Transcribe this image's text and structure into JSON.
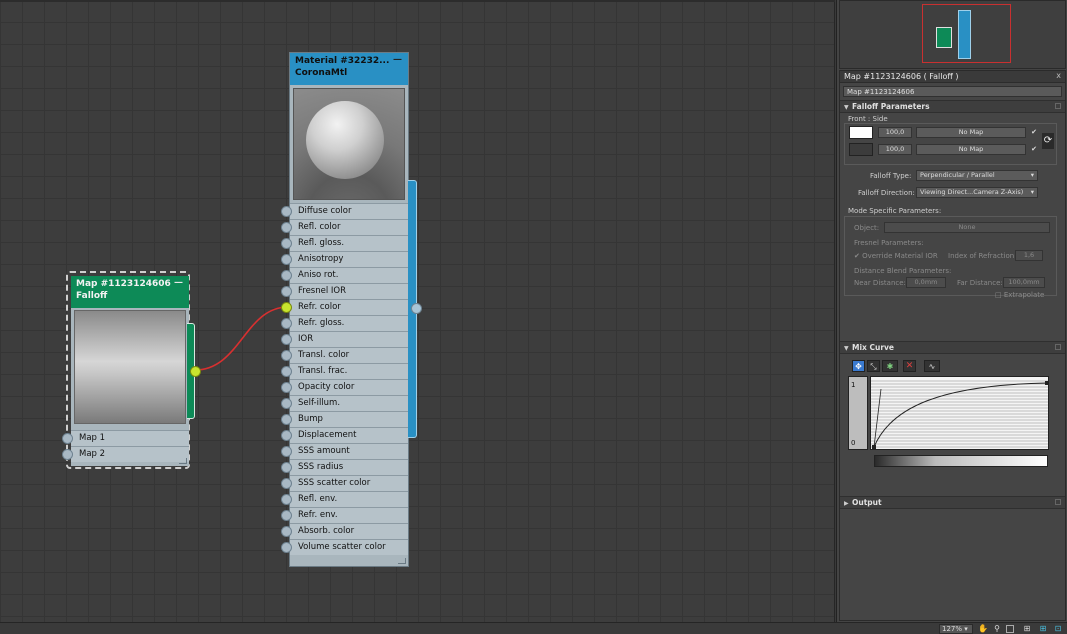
{
  "nodes": {
    "falloff": {
      "title": "Map #1123124606",
      "subtitle": "Falloff",
      "minimize": "—",
      "slots": [
        "Map 1",
        "Map 2"
      ]
    },
    "material": {
      "title": "Material  #32232...",
      "subtitle": "CoronaMtl",
      "minimize": "—",
      "slots": [
        "Diffuse color",
        "Refl. color",
        "Refl. gloss.",
        "Anisotropy",
        "Aniso rot.",
        "Fresnel IOR",
        "Refr. color",
        "Refr. gloss.",
        "IOR",
        "Transl. color",
        "Transl. frac.",
        "Opacity color",
        "Self-illum.",
        "Bump",
        "Displacement",
        "SSS amount",
        "SSS radius",
        "SSS scatter color",
        "Refl. env.",
        "Refr. env.",
        "Absorb. color",
        "Volume scatter color"
      ]
    }
  },
  "panel": {
    "title": "Map #1123124606  ( Falloff )",
    "close": "x",
    "map_name": "Map #1123124606",
    "falloff_params": {
      "header": "Falloff Parameters",
      "front_side_label": "Front : Side",
      "row1_value": "100,0",
      "row1_map": "No Map",
      "row2_value": "100,0",
      "row2_map": "No Map",
      "check": "✔",
      "swap": "⟳",
      "falloff_type_label": "Falloff Type:",
      "falloff_type_value": "Perpendicular / Parallel",
      "falloff_dir_label": "Falloff Direction:",
      "falloff_dir_value": "Viewing Direct...Camera Z-Axis)",
      "mode_label": "Mode Specific Parameters:",
      "object_label": "Object:",
      "object_value": "None",
      "fresnel_label": "Fresnel Parameters:",
      "override_ior": "✔ Override Material IOR",
      "ior_label": "Index of Refraction",
      "ior_value": "1,6",
      "distance_label": "Distance Blend Parameters:",
      "near_label": "Near Distance:",
      "near_value": "0,0mm",
      "far_label": "Far Distance:",
      "far_value": "100,0mm",
      "extrapolate": "□ Extrapolate"
    },
    "mix_curve": {
      "header": "Mix Curve",
      "y_top": "1",
      "y_bottom": "0"
    },
    "output": {
      "header": "Output"
    }
  },
  "status": {
    "zoom": "127% ▾"
  },
  "colors": {
    "falloff_header": "#0d8a57",
    "material_header": "#2990c4",
    "wire": "#d83030",
    "socket_active": "#c8e42e"
  }
}
